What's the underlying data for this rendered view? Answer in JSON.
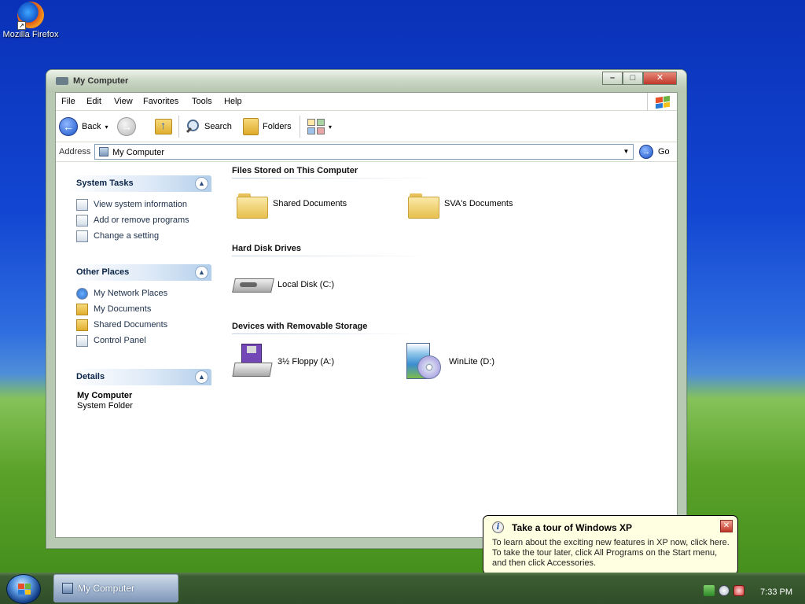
{
  "desktop": {
    "icons": [
      {
        "label": "Mozilla Firefox",
        "icon": "firefox-icon"
      }
    ]
  },
  "window": {
    "title": "My Computer",
    "buttons": {
      "minimize": "–",
      "maximize": "□",
      "close": "✕"
    }
  },
  "menubar": {
    "items": [
      "File",
      "Edit",
      "View",
      "Favorites",
      "Tools",
      "Help"
    ]
  },
  "toolbar": {
    "back_label": "Back",
    "search_label": "Search",
    "folders_label": "Folders"
  },
  "address": {
    "label": "Address",
    "value": "My Computer",
    "go_label": "Go"
  },
  "sidebar": {
    "system_tasks": {
      "title": "System Tasks",
      "items": [
        {
          "label": "View system information",
          "icon": "system-info-icon"
        },
        {
          "label": "Add or remove programs",
          "icon": "add-remove-icon"
        },
        {
          "label": "Change a setting",
          "icon": "control-panel-icon"
        }
      ]
    },
    "other_places": {
      "title": "Other Places",
      "items": [
        {
          "label": "My Network Places",
          "icon": "network-icon"
        },
        {
          "label": "My Documents",
          "icon": "documents-icon"
        },
        {
          "label": "Shared Documents",
          "icon": "folder-icon"
        },
        {
          "label": "Control Panel",
          "icon": "control-panel-icon"
        }
      ]
    },
    "details": {
      "title": "Details",
      "name": "My Computer",
      "type": "System Folder"
    }
  },
  "main": {
    "groups": [
      {
        "title": "Files Stored on This Computer",
        "items": [
          {
            "label": "Shared Documents",
            "icon": "folder-icon"
          },
          {
            "label": "SVA's Documents",
            "icon": "folder-icon"
          }
        ]
      },
      {
        "title": "Hard Disk Drives",
        "items": [
          {
            "label": "Local Disk (C:)",
            "icon": "hard-disk-icon"
          }
        ]
      },
      {
        "title": "Devices with Removable Storage",
        "items": [
          {
            "label": "3½ Floppy (A:)",
            "icon": "floppy-drive-icon"
          },
          {
            "label": "WinLite (D:)",
            "icon": "cd-drive-icon"
          }
        ]
      }
    ]
  },
  "balloon": {
    "title": "Take a tour of Windows XP",
    "lines": [
      "To learn about the exciting new features in XP now, click here.",
      "To take the tour later, click All Programs on the Start menu,",
      "and then click Accessories."
    ]
  },
  "taskbar": {
    "task_label": "My Computer",
    "clock": "7:33 PM"
  },
  "colors": {
    "desktop_top": "#0a31b8",
    "desktop_grass": "#5aa229",
    "window_frame": "#b7c9b2",
    "taskbar": "#2f4d28",
    "balloon_bg": "#ffffe1"
  }
}
